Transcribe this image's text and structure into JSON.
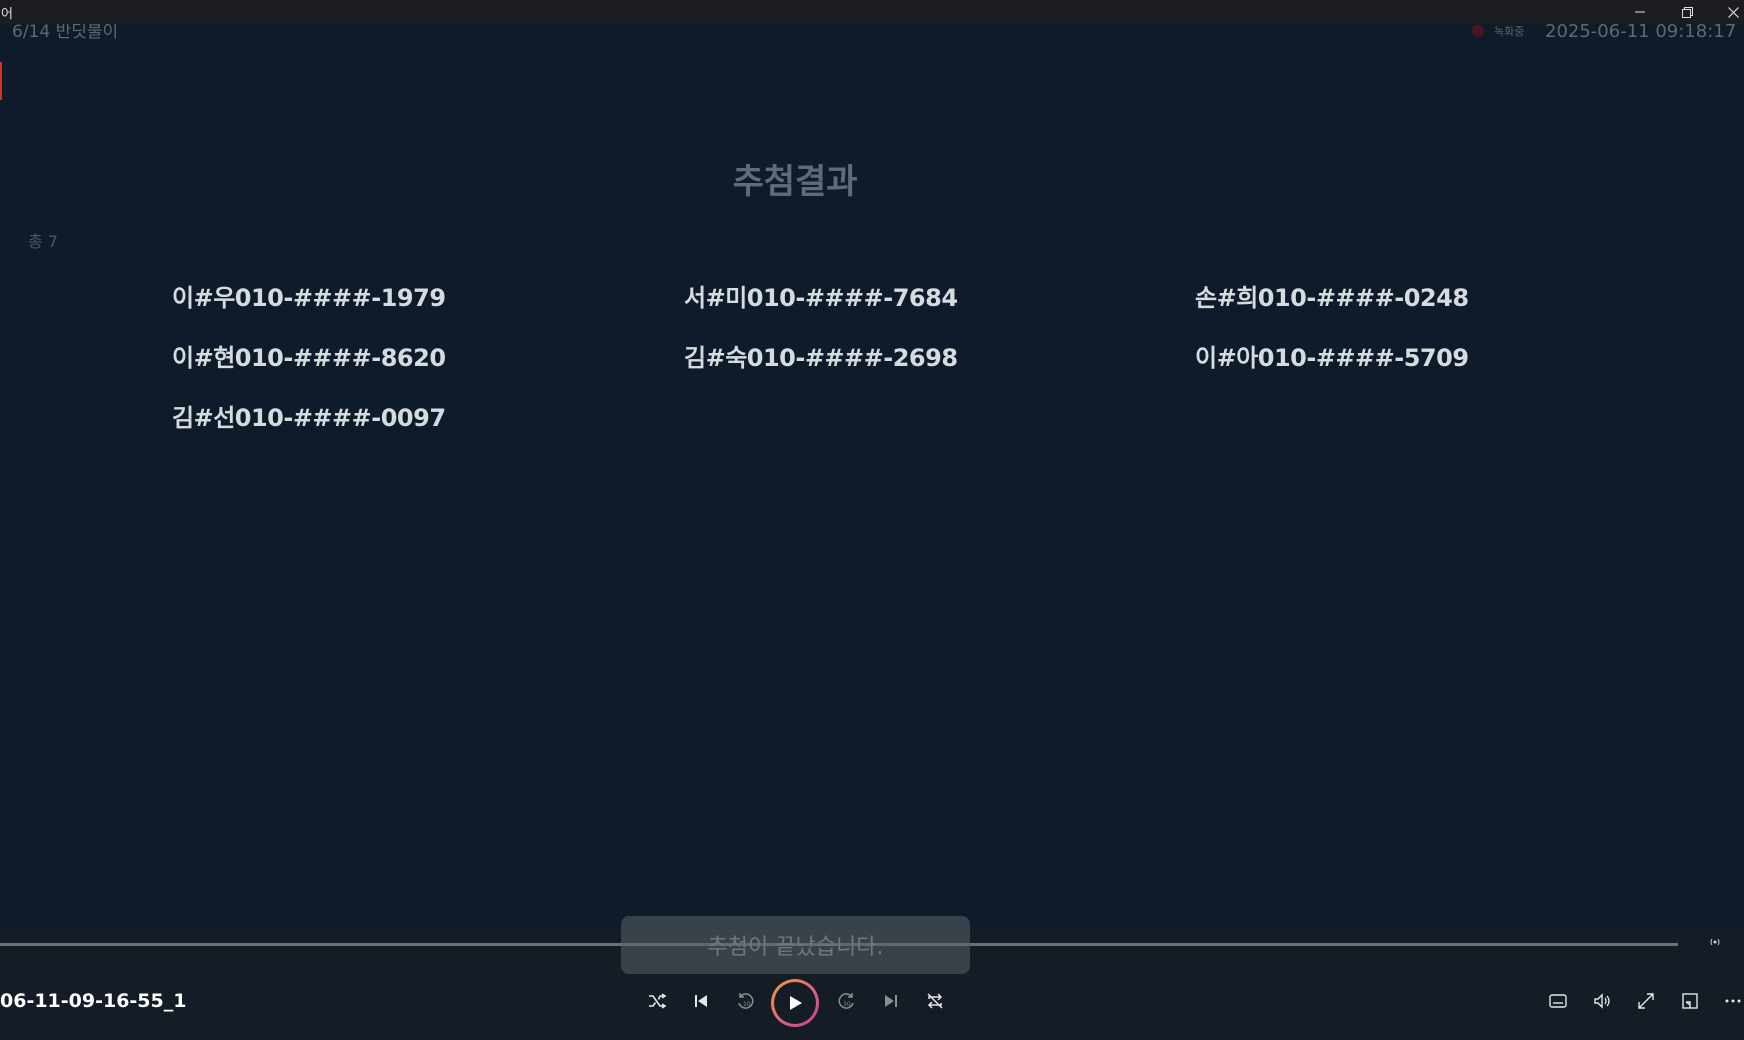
{
  "window": {
    "title": "어",
    "minimize_icon": "minimize-icon",
    "maximize_icon": "restore-icon",
    "close_icon": "close-icon"
  },
  "video": {
    "overlay_title": "6/14 반딧불이",
    "recording_label": "녹화중",
    "recording_time": "2025-06-11 09:18:17",
    "heading": "추첨결과",
    "total": "총 7",
    "winners": [
      "이#우010-####-1979",
      "서#미010-####-7684",
      "손#희010-####-0248",
      "이#현010-####-8620",
      "김#숙010-####-2698",
      "이#아010-####-5709",
      "김#선010-####-0097"
    ]
  },
  "player": {
    "file_name": "06-11-09-16-55_1",
    "toast": "추첨이 끝났습니다.",
    "progress": 0.0,
    "colors": {
      "play_ring_start": "#f39c3d",
      "play_ring_end": "#c83aa0",
      "background": "#0d1b2a"
    },
    "icons": [
      "shuffle-icon",
      "previous-icon",
      "rewind-10-icon",
      "play-icon",
      "forward-30-icon",
      "next-icon",
      "repeat-off-icon",
      "subtitles-icon",
      "volume-icon",
      "fullscreen-icon",
      "mini-player-icon",
      "more-icon",
      "live-icon"
    ]
  }
}
